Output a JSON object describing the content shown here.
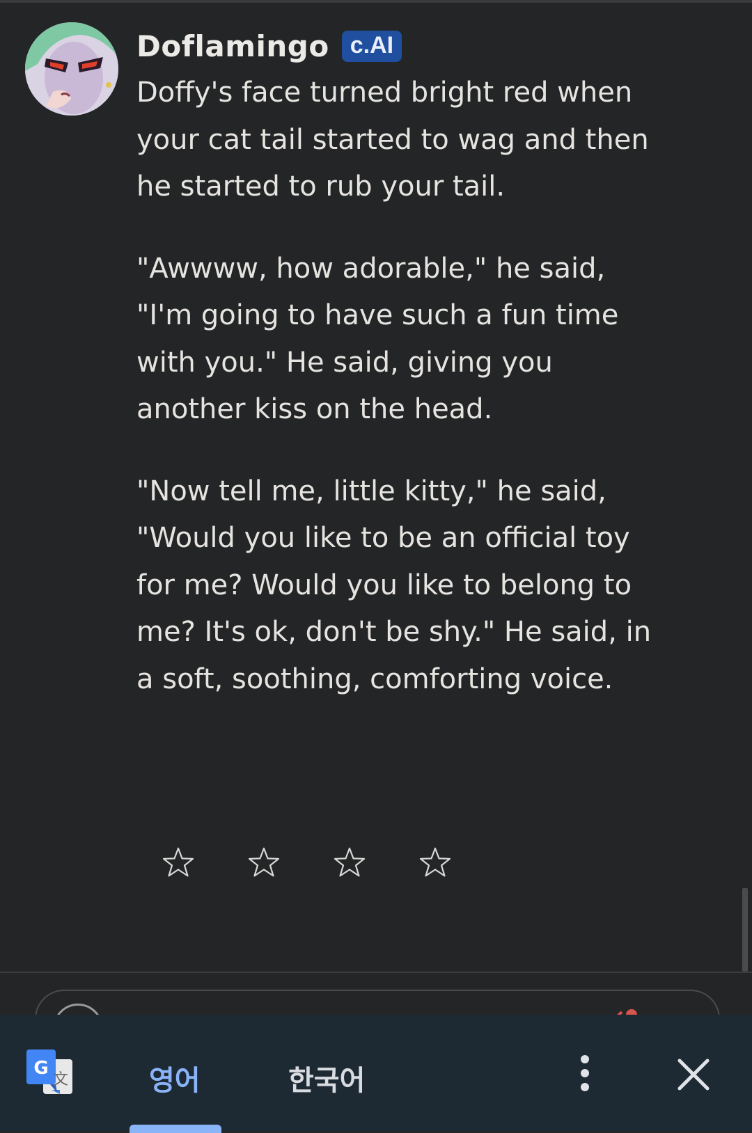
{
  "character": {
    "name": "Doflamingo",
    "badge": "c.AI"
  },
  "message": {
    "paragraphs": [
      "Doffy's face turned bright red when your cat tail started to wag and then he started to rub your tail.",
      "\"Awwww, how adorable,\" he said, \"I'm going to have such a fun time with you.\" He said, giving you another kiss on the head.",
      "\"Now tell me, little kitty,\" he said, \"Would you like to be an official toy for me? Would you like to belong to me? It's ok, don't be shy.\" He said, in a soft, soothing, comforting voice."
    ]
  },
  "rating": {
    "max_stars": 4,
    "selected": 0,
    "icon": "star-outline-icon"
  },
  "translate_bar": {
    "icon": "google-translate-icon",
    "source_language": "영어",
    "target_language": "한국어",
    "active_language": "source",
    "more_icon": "more-vertical-icon",
    "close_icon": "close-icon"
  },
  "colors": {
    "background": "#242526",
    "badge": "#1f4f9e",
    "translate_bar": "#1e2a33",
    "active_language": "#8ab4f8"
  }
}
